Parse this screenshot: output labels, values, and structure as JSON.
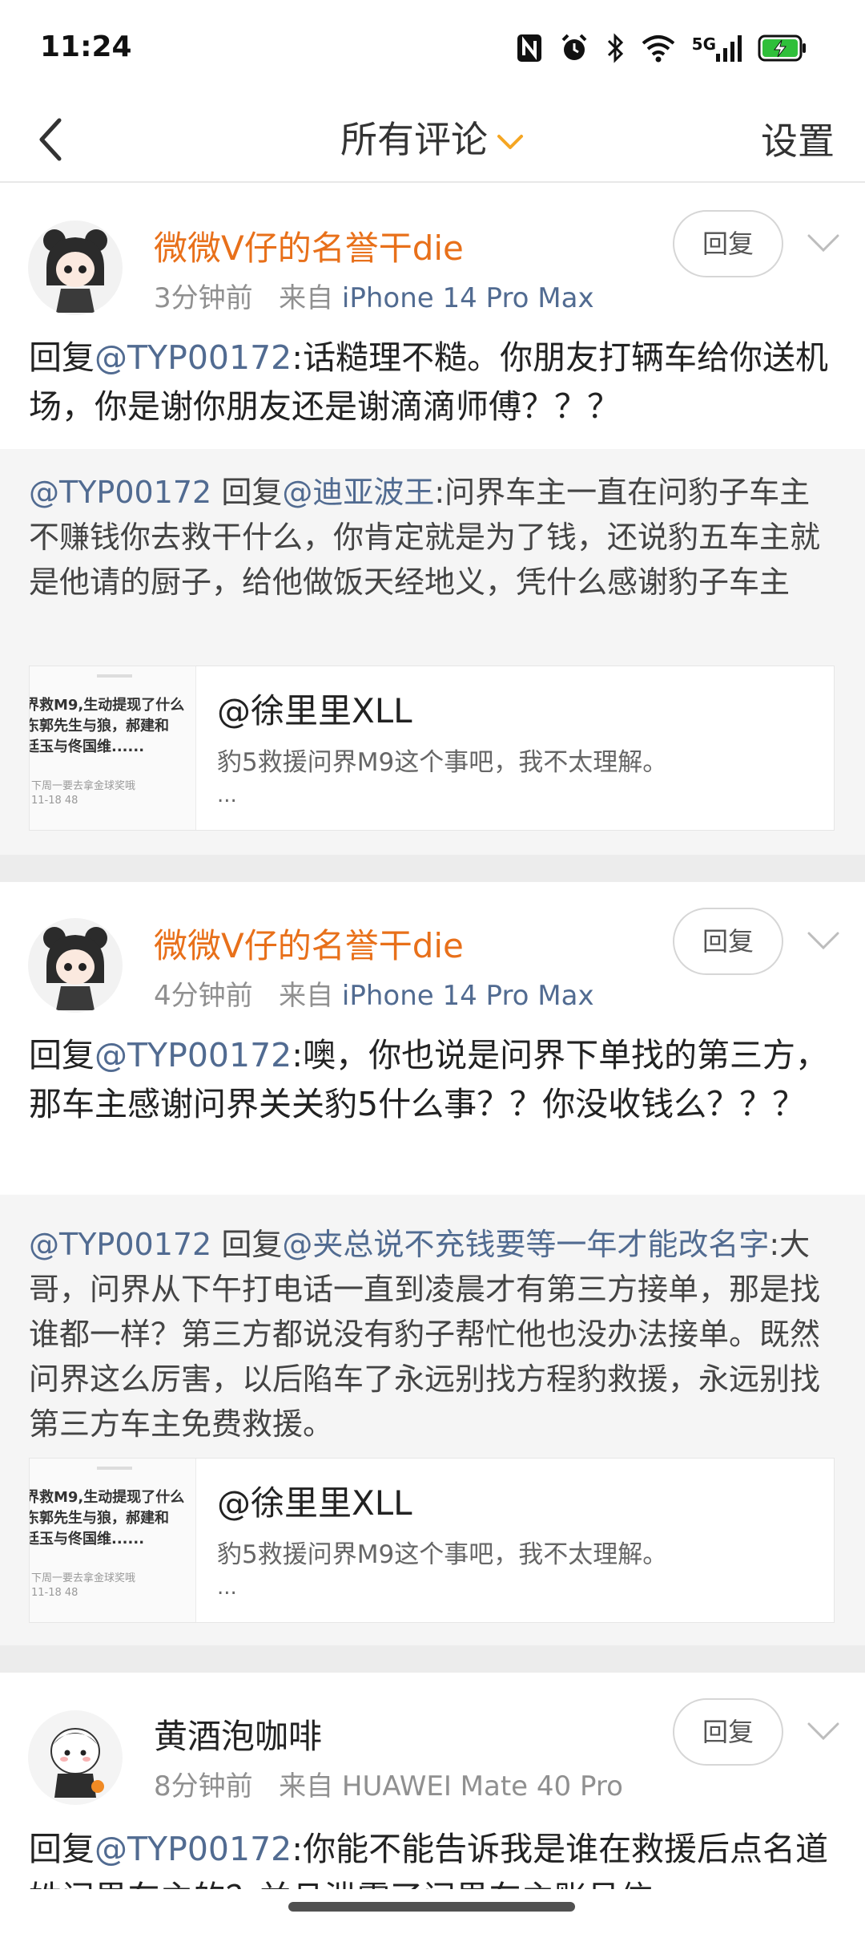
{
  "status_bar": {
    "time": "11:24",
    "network": "5G"
  },
  "nav": {
    "title": "所有评论",
    "settings": "设置"
  },
  "comments": [
    {
      "username": "微微V仔的名誉干die",
      "time": "3分钟前",
      "source_prefix": "来自",
      "device": "iPhone 14 Pro Max",
      "reply_label": "回复",
      "reply_prefix": "回复",
      "mention": "@TYP00172",
      "text": ":话糙理不糙。你朋友打辆车给你送机场，你是谢你朋友还是谢滴滴师傅？？？",
      "quote": {
        "author": "@TYP00172",
        "reply_word": " 回复",
        "target": "@迪亚波王",
        "text": ":问界车主一直在问豹子车主  不赚钱你去救干什么，你肯定就是为了钱，还说豹五车主就是他请的厨子，给他做饭天经地义，凭什么感谢豹子车主"
      },
      "card": {
        "title": "@徐里里XLL",
        "desc": "豹5救援问界M9这个事吧，我不太理解。",
        "ellipsis": "...",
        "thumb_lines": [
          "界救M9,生动提现了什么",
          "东郭先生与狼，郝建和",
          "廷玉与佟国维......"
        ],
        "thumb_footer": "下周一要去拿金球奖哦",
        "thumb_time": "11-18 48"
      }
    },
    {
      "username": "微微V仔的名誉干die",
      "time": "4分钟前",
      "source_prefix": "来自",
      "device": "iPhone 14 Pro Max",
      "reply_label": "回复",
      "reply_prefix": "回复",
      "mention": "@TYP00172",
      "text": ":噢，你也说是问界下单找的第三方，那车主感谢问界关关豹5什么事？？你没收钱么？？？",
      "quote": {
        "author": "@TYP00172",
        "reply_word": " 回复",
        "target": "@夹总说不充钱要等一年才能改名字",
        "text": ":大哥，问界从下午打电话一直到凌晨才有第三方接单，那是找谁都一样？第三方都说没有豹子帮忙他也没办法接单。既然问界这么厉害，以后陷车了永远别找方程豹救援，永远别找第三方车主免费救援。"
      },
      "card": {
        "title": "@徐里里XLL",
        "desc": "豹5救援问界M9这个事吧，我不太理解。",
        "ellipsis": "...",
        "thumb_lines": [
          "界救M9,生动提现了什么",
          "东郭先生与狼，郝建和",
          "廷玉与佟国维......"
        ],
        "thumb_footer": "下周一要去拿金球奖哦",
        "thumb_time": "11-18 48"
      }
    },
    {
      "username": "黄酒泡咖啡",
      "time": "8分钟前",
      "source_prefix": "来自",
      "device": "HUAWEI Mate 40 Pro",
      "reply_label": "回复",
      "reply_prefix": "回复",
      "mention": "@TYP00172",
      "text": ":你能不能告诉我是谁在救援后点名道姓问界车主的？并且泄露了问界车主账号信"
    }
  ],
  "colors": {
    "username_vip": "#e8701a",
    "link": "#516b91",
    "meta": "#909090",
    "accent": "#f5a623"
  },
  "icons": [
    "nfc-icon",
    "alarm-icon",
    "bluetooth-icon",
    "wifi-icon",
    "signal-icon",
    "battery-charging-icon",
    "back-arrow-icon",
    "chevron-down-icon"
  ]
}
